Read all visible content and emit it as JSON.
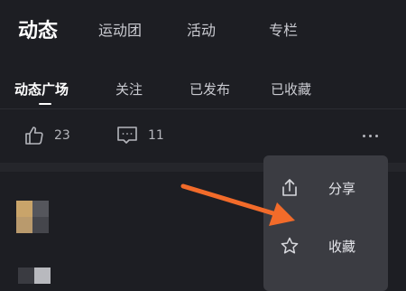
{
  "top_nav": {
    "active": "动态",
    "items": [
      "运动团",
      "活动",
      "专栏"
    ]
  },
  "sub_tabs": [
    "动态广场",
    "关注",
    "已发布",
    "已收藏"
  ],
  "actions": {
    "like_count": "23",
    "comment_count": "11"
  },
  "popup_menu": {
    "items": [
      {
        "label": "分享",
        "icon": "share-icon"
      },
      {
        "label": "收藏",
        "icon": "star-icon"
      }
    ]
  },
  "colors": {
    "background": "#1d1e23",
    "menu_background": "#3b3c42",
    "arrow": "#f26b2a"
  }
}
